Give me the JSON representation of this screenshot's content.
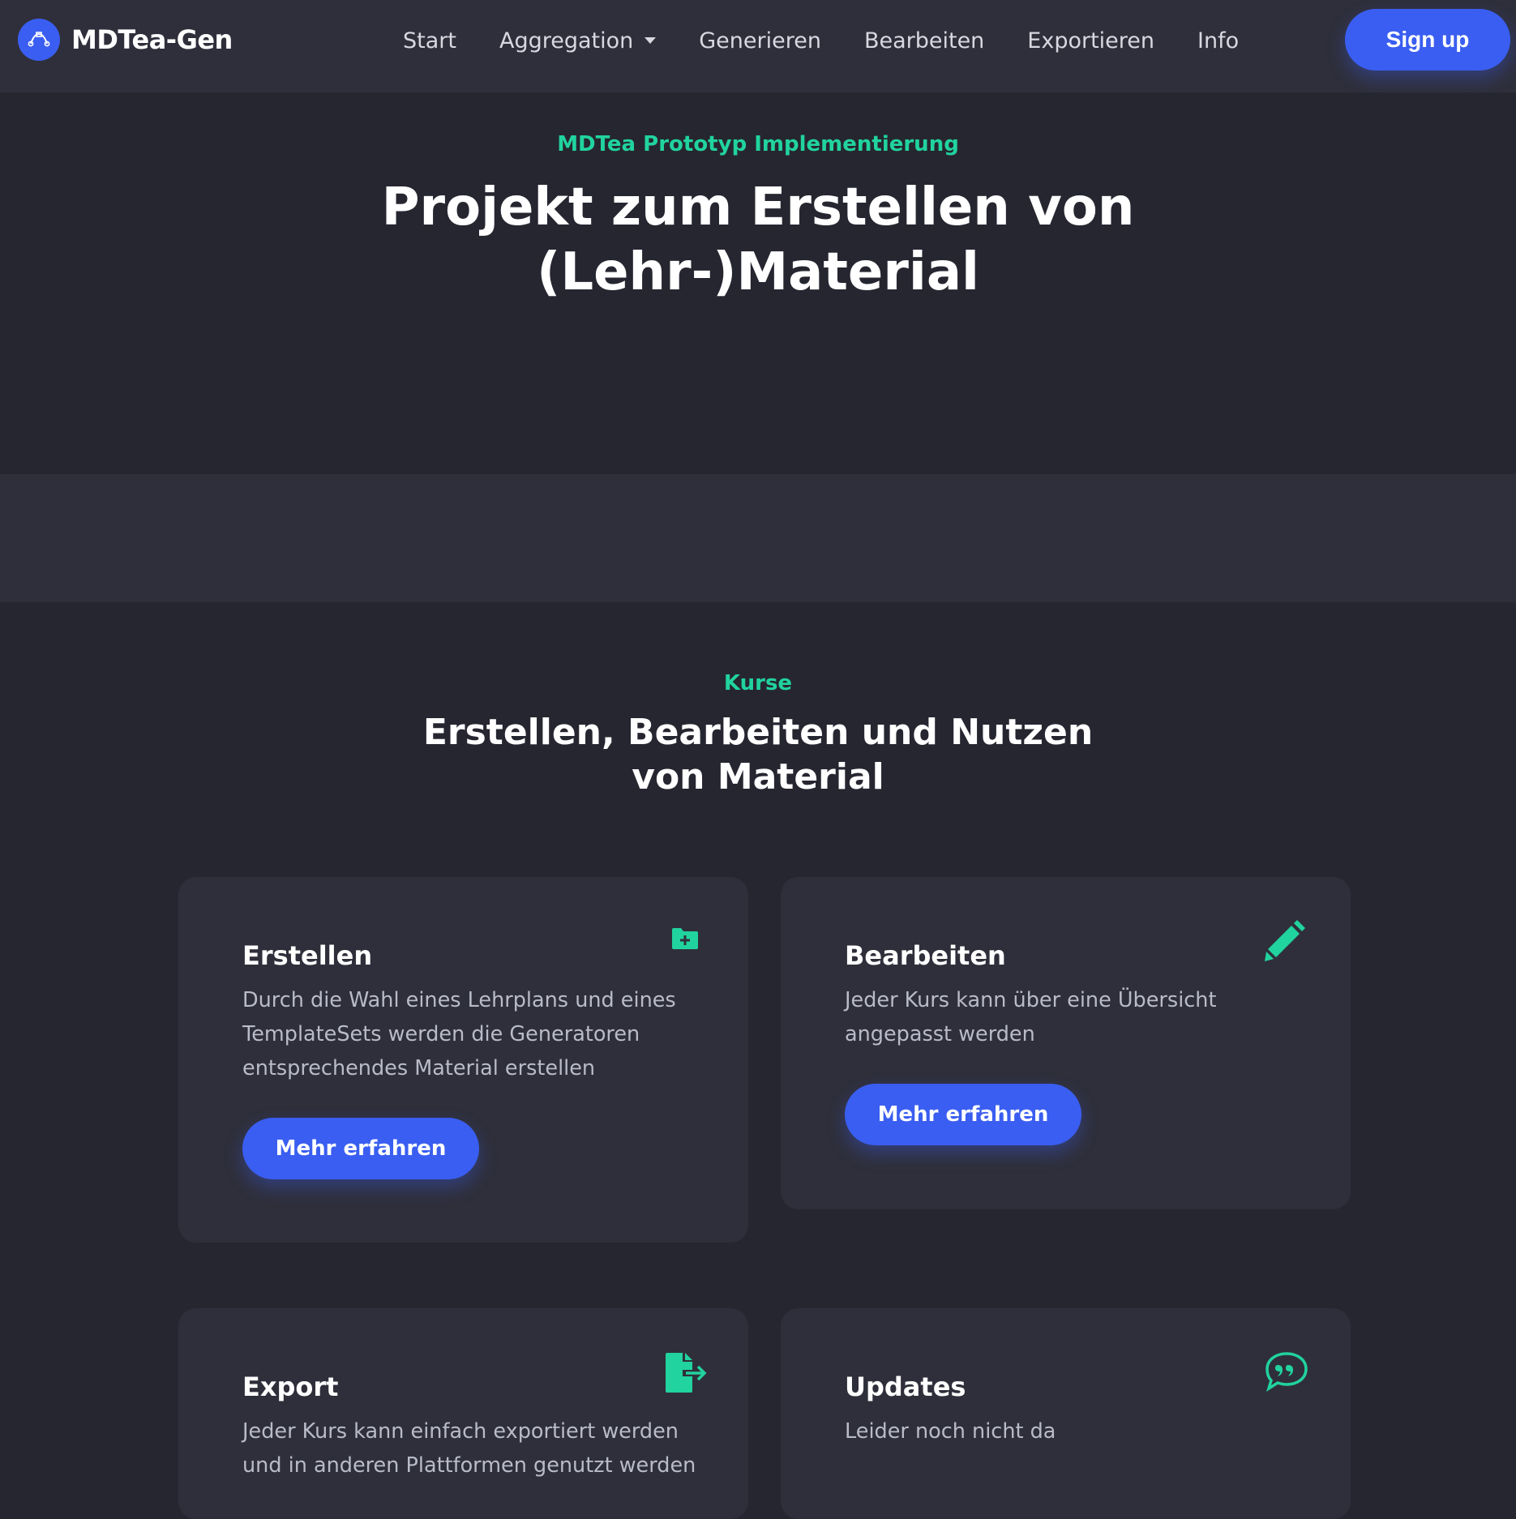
{
  "navbar": {
    "brand": "MDTea-Gen",
    "links": [
      "Start",
      "Aggregation",
      "Generieren",
      "Bearbeiten",
      "Exportieren",
      "Info"
    ],
    "signup_label": "Sign up"
  },
  "hero": {
    "kicker": "MDTea Prototyp Implementierung",
    "title": "Projekt zum Erstellen von (Lehr-)Material"
  },
  "features": {
    "kicker": "Kurse",
    "title": "Erstellen, Bearbeiten und Nutzen von Material",
    "cards": [
      {
        "title": "Erstellen",
        "text": "Durch die Wahl eines Lehrplans und eines TemplateSets werden die Generatoren entsprechendes Material erstellen",
        "button": "Mehr erfahren",
        "icon": "folder-plus-icon"
      },
      {
        "title": "Bearbeiten",
        "text": "Jeder Kurs kann über eine Übersicht angepasst werden",
        "button": "Mehr erfahren",
        "icon": "pencil-icon"
      },
      {
        "title": "Export",
        "text": "Jeder Kurs kann einfach exportiert werden und in anderen Plattformen genutzt werden",
        "icon": "file-export-icon"
      },
      {
        "title": "Updates",
        "text": "Leider noch nicht da",
        "icon": "quote-bubble-icon"
      }
    ]
  },
  "colors": {
    "background": "#262631",
    "surface": "#2f2f3b",
    "accent": "#3a5ef1",
    "green": "#21d39e"
  }
}
